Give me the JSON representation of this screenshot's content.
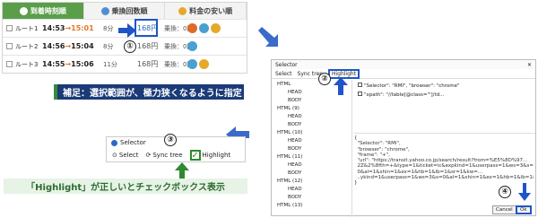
{
  "routes": {
    "tabs": [
      {
        "label": "到着時刻順",
        "icon": "clock-icon"
      },
      {
        "label": "乗換回数順",
        "icon": "train-icon"
      },
      {
        "label": "料金の安い順",
        "icon": "yen-icon"
      }
    ],
    "rows": [
      {
        "name": "ルート1",
        "dep": "14:53",
        "arr": "15:01",
        "dur": "8分",
        "fare": "168円",
        "xfer": "乗換：0回"
      },
      {
        "name": "ルート2",
        "dep": "14:56",
        "arr": "15:04",
        "dur": "8分",
        "fare": "168円",
        "xfer": "乗換：0回"
      },
      {
        "name": "ルート3",
        "dep": "14:55",
        "arr": "15:06",
        "dur": "11分",
        "fare": "168円",
        "xfer": "乗換：0回"
      }
    ],
    "arrow_sep": "→"
  },
  "steps": {
    "s1": "①",
    "s2": "②",
    "s3": "③",
    "s4": "④"
  },
  "note_top": "補足：選択範囲が、極力狭くなるように指定",
  "note_bottom": "「Highlight」が正しいとチェックボックス表示",
  "small_selector": {
    "title": "Selector",
    "select": "Select",
    "sync_tree": "Sync tree",
    "highlight": "Highlight",
    "checkmark": "✓"
  },
  "big_selector": {
    "title": "Selector",
    "close": "✕",
    "select": "Select",
    "sync_tree": "Sync tree",
    "highlight": "Highlight",
    "props": [
      "\"Selector\": \"RMI\",  \"browser\": \"chrome\"",
      "\"xpath\": \"//table[@class='\"]/td..."
    ],
    "tree": [
      "HTML",
      "HEAD",
      "BODY",
      "HTML (9)",
      "HEAD",
      "BODY",
      "HTML (10)",
      "HEAD",
      "BODY",
      "HTML (11)",
      "HEAD",
      "BODY",
      "HTML (12)",
      "HEAD",
      "BODY",
      "HTML (13)"
    ],
    "json": "{\n  \"Selector\": \"RMI\",\n  \"browser\": \"chrome\",\n  \"frame\": \"+\",\n  \"url\": \"https://transit.yahoo.co.jp/search/result?from=%E5%8D%97...\n  2Z&2%8fth=+&type=1&ticket=ic&expkind=1&userpass=1&ws=3&s=\n  0&al=1&shin=1&ex=1&hb=1&lb=1&sr=1&kw=...\n  ..ykind=1&userpass=1&ws=3&s=0&al=1&shin=1&ex=1&hb=1&lb=1&s\n}",
    "cancel": "Cancel",
    "ok": "Ok"
  },
  "colors": {
    "accent": "#1f55c9",
    "green": "#5a9e4a",
    "navy": "#1a3a78"
  }
}
